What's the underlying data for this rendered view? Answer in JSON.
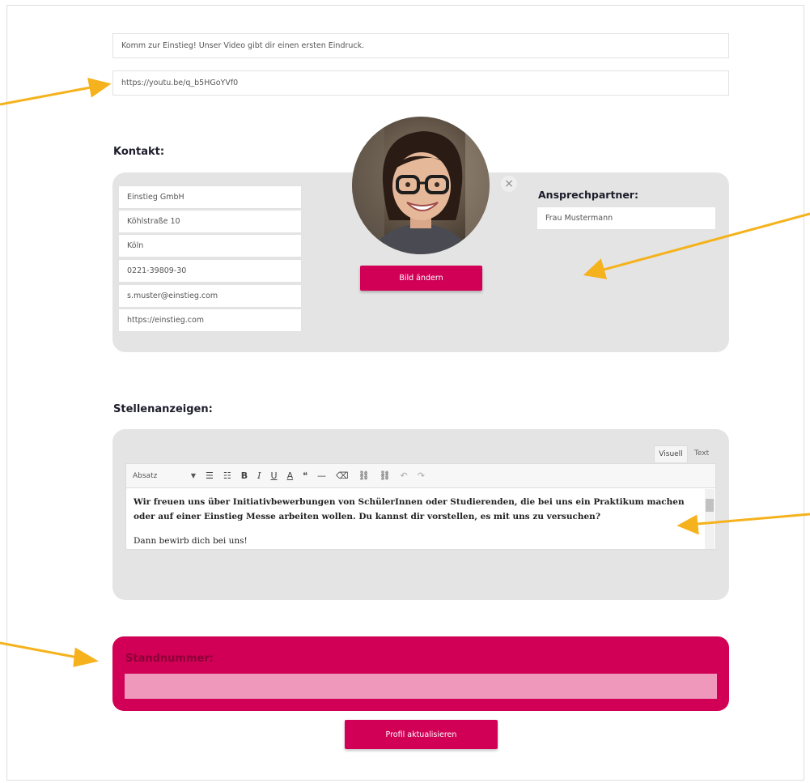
{
  "intro": {
    "video_text": "Komm zur Einstieg! Unser Video gibt dir einen ersten Eindruck.",
    "video_url": "https://youtu.be/q_b5HGoYVf0"
  },
  "contact": {
    "heading": "Kontakt:",
    "fields": [
      "Einstieg GmbH",
      "Köhlstraße 10",
      "Köln",
      "0221-39809-30",
      "s.muster@einstieg.com",
      "https://einstieg.com"
    ],
    "change_image_label": "Bild ändern",
    "close_icon": "×",
    "partner_heading": "Ansprechpartner:",
    "partner_value": "Frau Mustermann"
  },
  "jobs": {
    "heading": "Stellenanzeigen:",
    "tab_visual": "Visuell",
    "tab_text": "Text",
    "format_select": "Absatz",
    "toolbar": {
      "bullet_list": "☰",
      "numbered_list": "☷",
      "bold": "B",
      "italic": "I",
      "underline": "U",
      "text_color": "A",
      "quote": "❝",
      "hr": "—",
      "eraser": "⌫",
      "link": "⛓",
      "unlink": "⛓",
      "undo": "↶",
      "redo": "↷"
    },
    "paragraph1": "Wir freuen uns über Initiativbewerbungen von SchülerInnen oder Studierenden, die bei uns ein Praktikum machen oder auf einer Einstieg Messe arbeiten wollen. Du kannst dir vorstellen, es mit uns zu versuchen?",
    "paragraph2": "Dann bewirb dich bei uns!"
  },
  "booth": {
    "heading": "Standnummer:",
    "value": ""
  },
  "submit_label": "Profil aktualisieren",
  "colors": {
    "accent": "#d10056",
    "arrow": "#f5b21c",
    "panel": "#e4e4e4"
  }
}
